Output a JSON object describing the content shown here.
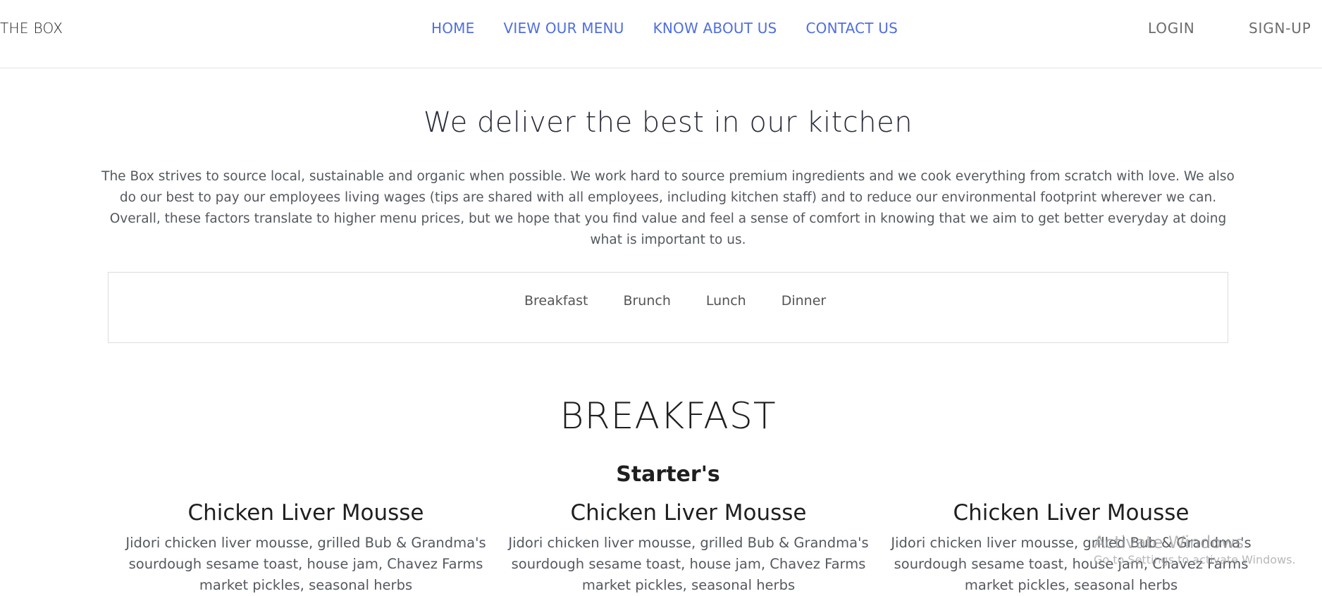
{
  "brand": "THE BOX",
  "nav": {
    "links": [
      "HOME",
      "VIEW OUR MENU",
      "KNOW ABOUT US",
      "CONTACT US"
    ],
    "login": "LOGIN",
    "signup": "SIGN-UP"
  },
  "colors": {
    "nav_link": "#4f6fdf",
    "auth_link": "#6c6c6c",
    "text_body": "#55585f",
    "heading": "#1f1f1f"
  },
  "hero": {
    "headline": "We deliver the best in our kitchen",
    "paragraph": "The Box strives to source local, sustainable and organic when possible. We work hard to source premium ingredients and we cook everything from scratch with love. We also do our best to pay our employees living wages (tips are shared with all employees, including kitchen staff) and to reduce our environmental footprint wherever we can. Overall, these factors translate to higher menu prices, but we hope that you find value and feel a sense of comfort in knowing that we aim to get better everyday at doing what is important to us."
  },
  "menu_tabs": [
    "Breakfast",
    "Brunch",
    "Lunch",
    "Dinner"
  ],
  "section": {
    "title": "BREAKFAST",
    "subtitle": "Starter's"
  },
  "dishes": [
    {
      "name": "Chicken Liver Mousse",
      "description": "Jidori chicken liver mousse, grilled Bub & Grandma's sourdough sesame toast, house jam, Chavez Farms market pickles, seasonal herbs"
    },
    {
      "name": "Chicken Liver Mousse",
      "description": "Jidori chicken liver mousse, grilled Bub & Grandma's sourdough sesame toast, house jam, Chavez Farms market pickles, seasonal herbs"
    },
    {
      "name": "Chicken Liver Mousse",
      "description": "Jidori chicken liver mousse, grilled Bub & Grandma's sourdough sesame toast, house jam, Chavez Farms market pickles, seasonal herbs"
    }
  ],
  "watermark": {
    "title": "Activate Windows",
    "subtitle": "Go to Settings to activate Windows."
  }
}
